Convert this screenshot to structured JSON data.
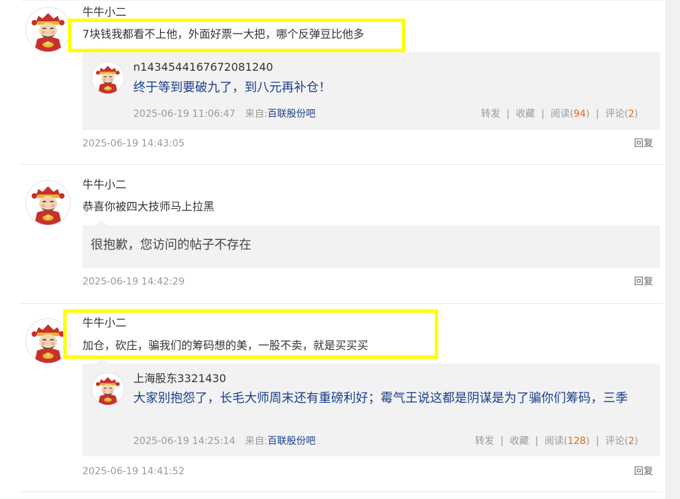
{
  "comments": [
    {
      "username": "牛牛小二",
      "text": "7块钱我都看不上他，外面好票一大把，哪个反弹豆比他多",
      "quote": {
        "username": "n1434544167672081240",
        "text": "终于等到要破九了，到八元再补仓！",
        "time": "2025-06-19 11:06:47",
        "source_label": "来自:",
        "source": "百联股份吧",
        "forward": "转发",
        "favorite": "收藏",
        "read_label": "阅读",
        "read_count": "94",
        "comment_label": "评论",
        "comment_count": "2"
      },
      "time": "2025-06-19 14:43:05",
      "reply": "回复"
    },
    {
      "username": "牛牛小二",
      "text": "恭喜你被四大技师马上拉黑",
      "notice": "很抱歉，您访问的帖子不存在",
      "time": "2025-06-19 14:42:29",
      "reply": "回复"
    },
    {
      "username": "牛牛小二",
      "text": "加仓，砍庄，骗我们的筹码想的美，一股不卖，就是买买买",
      "quote": {
        "username": "上海股东3321430",
        "text": "大家别抱怨了，长毛大师周末还有重磅利好；霉气王说这都是阴谋是为了骗你们筹码，三季",
        "time": "2025-06-19 14:25:14",
        "source_label": "来自:",
        "source": "百联股份吧",
        "forward": "转发",
        "favorite": "收藏",
        "read_label": "阅读",
        "read_count": "128",
        "comment_label": "评论",
        "comment_count": "2"
      },
      "time": "2025-06-19 14:41:52",
      "reply": "回复"
    }
  ],
  "colors": {
    "highlight": "#ffff00",
    "link": "#1a3f8f",
    "count": "#e06a16"
  }
}
